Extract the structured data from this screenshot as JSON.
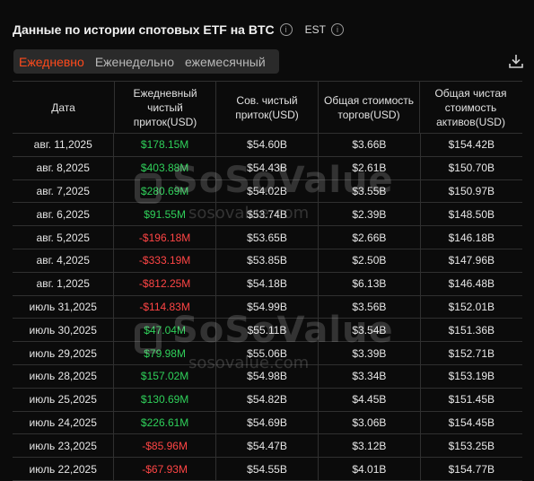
{
  "header": {
    "title": "Данные по истории спотовых ETF на BTC",
    "timezone": "EST"
  },
  "tabs": [
    {
      "label": "Ежедневно",
      "active": true
    },
    {
      "label": "Еженедельно",
      "active": false
    },
    {
      "label": "ежемесячный",
      "active": false
    }
  ],
  "table": {
    "columns": [
      "Дата",
      "Ежедневный чистый приток(USD)",
      "Сов. чистый приток(USD)",
      "Общая стоимость торгов(USD)",
      "Общая чистая стоимость активов(USD)"
    ],
    "rows": [
      {
        "date": "авг. 11,2025",
        "flow": "$178.15M",
        "sign": "pos",
        "cum": "$54.60B",
        "trade": "$3.66B",
        "assets": "$154.42B"
      },
      {
        "date": "авг. 8,2025",
        "flow": "$403.88M",
        "sign": "pos",
        "cum": "$54.43B",
        "trade": "$2.61B",
        "assets": "$150.70B"
      },
      {
        "date": "авг. 7,2025",
        "flow": "$280.69M",
        "sign": "pos",
        "cum": "$54.02B",
        "trade": "$3.55B",
        "assets": "$150.97B"
      },
      {
        "date": "авг. 6,2025",
        "flow": "$91.55M",
        "sign": "pos",
        "cum": "$53.74B",
        "trade": "$2.39B",
        "assets": "$148.50B"
      },
      {
        "date": "авг. 5,2025",
        "flow": "-$196.18M",
        "sign": "neg",
        "cum": "$53.65B",
        "trade": "$2.66B",
        "assets": "$146.18B"
      },
      {
        "date": "авг. 4,2025",
        "flow": "-$333.19M",
        "sign": "neg",
        "cum": "$53.85B",
        "trade": "$2.50B",
        "assets": "$147.96B"
      },
      {
        "date": "авг. 1,2025",
        "flow": "-$812.25M",
        "sign": "neg",
        "cum": "$54.18B",
        "trade": "$6.13B",
        "assets": "$146.48B"
      },
      {
        "date": "июль 31,2025",
        "flow": "-$114.83M",
        "sign": "neg",
        "cum": "$54.99B",
        "trade": "$3.56B",
        "assets": "$152.01B"
      },
      {
        "date": "июль 30,2025",
        "flow": "$47.04M",
        "sign": "pos",
        "cum": "$55.11B",
        "trade": "$3.54B",
        "assets": "$151.36B"
      },
      {
        "date": "июль 29,2025",
        "flow": "$79.98M",
        "sign": "pos",
        "cum": "$55.06B",
        "trade": "$3.39B",
        "assets": "$152.71B"
      },
      {
        "date": "июль 28,2025",
        "flow": "$157.02M",
        "sign": "pos",
        "cum": "$54.98B",
        "trade": "$3.34B",
        "assets": "$153.19B"
      },
      {
        "date": "июль 25,2025",
        "flow": "$130.69M",
        "sign": "pos",
        "cum": "$54.82B",
        "trade": "$4.45B",
        "assets": "$151.45B"
      },
      {
        "date": "июль 24,2025",
        "flow": "$226.61M",
        "sign": "pos",
        "cum": "$54.69B",
        "trade": "$3.06B",
        "assets": "$154.45B"
      },
      {
        "date": "июль 23,2025",
        "flow": "-$85.96M",
        "sign": "neg",
        "cum": "$54.47B",
        "trade": "$3.12B",
        "assets": "$153.25B"
      },
      {
        "date": "июль 22,2025",
        "flow": "-$67.93M",
        "sign": "neg",
        "cum": "$54.55B",
        "trade": "$4.01B",
        "assets": "$154.77B"
      }
    ]
  },
  "watermark": {
    "brand": "SoSoValue",
    "url": "sosovalue.com"
  },
  "colors": {
    "accent": "#ff4a1c",
    "positive": "#2fd05a",
    "negative": "#ff4545"
  }
}
